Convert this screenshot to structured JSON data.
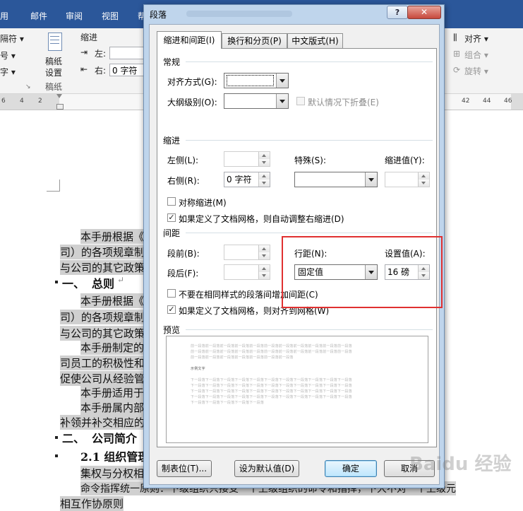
{
  "word": {
    "tabs": [
      "用",
      "邮件",
      "审阅",
      "视图",
      "帮"
    ],
    "left_group": {
      "item1": "隔符 ▾",
      "item2": "号 ▾",
      "item3": "字 ▾"
    },
    "paper_group": {
      "icon_label_1": "稿纸",
      "icon_label_2": "设置",
      "group_label": "稿纸"
    },
    "indent_group": {
      "title": "缩进",
      "left_label": "左:",
      "right_label": "右:",
      "right_value": "0 字符"
    },
    "arrange_group": {
      "align": "对齐 ▾",
      "group": "组合 ▾",
      "rotate": "旋转 ▾"
    },
    "ruler_left": [
      "6",
      "4",
      "2"
    ],
    "ruler_right": [
      "42",
      "44",
      "46"
    ],
    "document": {
      "line1": "本手册根据《中",
      "line2": "司）的各项规章制度编",
      "line3": "与公司的其它政策一",
      "heading1_num": "一、",
      "heading1": "总则",
      "line4": "本手册根据《中",
      "line5": "司）的各项规章制度编",
      "line6": "与公司的其它政策一",
      "line7": "本手册制定的目",
      "line8": "司员工的积极性和创",
      "line9": "促使公司从经验管理",
      "line10": "本手册适用于本",
      "line11": "本手册属内部资",
      "line12": "补领并补交相应的工",
      "heading2_num": "二、",
      "heading2": "公司简介",
      "heading3": "2.1 组织管理",
      "line13": "集权与分权相结",
      "line14": "命令指挥统一原则：下级组织只接受一个上级组织的命令和指挥，下大不对一个上级元",
      "line15": "相互作协原则"
    }
  },
  "dialog": {
    "title": "段落",
    "help": "?",
    "close": "✕",
    "tabs": [
      "缩进和间距(I)",
      "换行和分页(P)",
      "中文版式(H)"
    ],
    "general": {
      "title": "常规",
      "alignment_label": "对齐方式(G):",
      "alignment_value": "",
      "outline_label": "大纲级别(O):",
      "outline_value": "",
      "collapse_label": "默认情况下折叠(E)"
    },
    "indent": {
      "title": "缩进",
      "left_label": "左侧(L):",
      "left_value": "",
      "right_label": "右侧(R):",
      "right_value": "0 字符",
      "special_label": "特殊(S):",
      "special_value": "",
      "by_label": "缩进值(Y):",
      "by_value": "",
      "mirror_label": "对称缩进(M)",
      "mirror_checked": false,
      "auto_adjust_label": "如果定义了文档网格，则自动调整右缩进(D)",
      "auto_adjust_checked": true
    },
    "spacing": {
      "title": "间距",
      "before_label": "段前(B):",
      "before_value": "",
      "after_label": "段后(F):",
      "after_value": "",
      "line_spacing_label": "行距(N):",
      "line_spacing_value": "固定值",
      "at_label": "设置值(A):",
      "at_value": "16 磅",
      "no_space_label": "不要在相同样式的段落间增加间距(C)",
      "no_space_checked": false,
      "snap_grid_label": "如果定义了文档网格，则对齐到网格(W)",
      "snap_grid_checked": true
    },
    "preview": {
      "title": "预览",
      "prev_line": "前一段落前一段落前一段落前一段落前一段落前一段落前一段落前一段落前一段落前一段落前一段落",
      "prev_line_short": "前一段落前一段落前一段落前一段落前一段落前一段落前一段落",
      "sample_text": "示例文字",
      "next_line": "下一段落下一段落下一段落下一段落下一段落下一段落下一段落下一段落下一段落下一段落下一段落",
      "next_line_short": "下一段落下一段落下一段落下一段落下一段落"
    },
    "buttons": {
      "tabs": "制表位(T)...",
      "default": "设为默认值(D)",
      "ok": "确定",
      "cancel": "取消"
    }
  },
  "watermark": "Baidu 经验",
  "colors": {
    "ribbon": "#2b579a",
    "highlight_box": "#e03030",
    "dialog_frame": "#bfd5ec"
  }
}
